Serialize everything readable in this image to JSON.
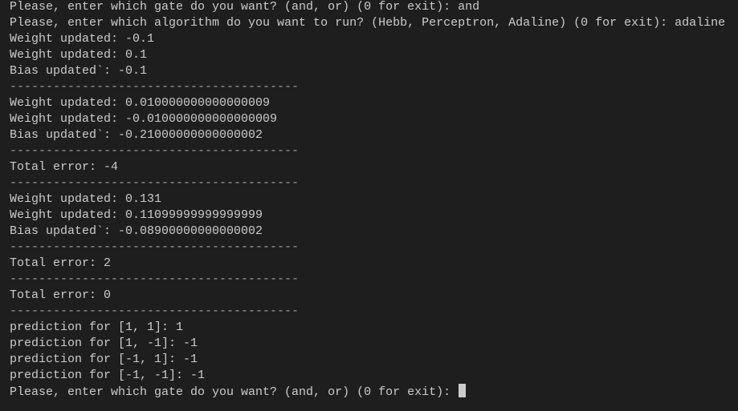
{
  "terminal": {
    "lines": [
      {
        "type": "prompt",
        "text": "Please, enter which gate do you want? (and, or) (0 for exit): ",
        "input": "and"
      },
      {
        "type": "prompt",
        "text": "Please, enter which algorithm do you want to run? (Hebb, Perceptron, Adaline) (0 for exit): ",
        "input": "adaline"
      },
      {
        "type": "output",
        "text": "Weight updated: -0.1"
      },
      {
        "type": "output",
        "text": "Weight updated: 0.1"
      },
      {
        "type": "output",
        "text": "Bias updated`: -0.1"
      },
      {
        "type": "separator",
        "text": "----------------------------------------"
      },
      {
        "type": "output",
        "text": "Weight updated: 0.010000000000000009"
      },
      {
        "type": "output",
        "text": "Weight updated: -0.010000000000000009"
      },
      {
        "type": "output",
        "text": "Bias updated`: -0.21000000000000002"
      },
      {
        "type": "separator",
        "text": "----------------------------------------"
      },
      {
        "type": "output",
        "text": "Total error: -4"
      },
      {
        "type": "separator",
        "text": "----------------------------------------"
      },
      {
        "type": "output",
        "text": "Weight updated: 0.131"
      },
      {
        "type": "output",
        "text": "Weight updated: 0.11099999999999999"
      },
      {
        "type": "output",
        "text": "Bias updated`: -0.08900000000000002"
      },
      {
        "type": "separator",
        "text": "----------------------------------------"
      },
      {
        "type": "output",
        "text": "Total error: 2"
      },
      {
        "type": "separator",
        "text": "----------------------------------------"
      },
      {
        "type": "output",
        "text": "Total error: 0"
      },
      {
        "type": "separator",
        "text": "----------------------------------------"
      },
      {
        "type": "output",
        "text": "prediction for [1, 1]: 1"
      },
      {
        "type": "output",
        "text": "prediction for [1, -1]: -1"
      },
      {
        "type": "output",
        "text": "prediction for [-1, 1]: -1"
      },
      {
        "type": "output",
        "text": "prediction for [-1, -1]: -1"
      }
    ],
    "current_prompt": {
      "text": "Please, enter which gate do you want? (and, or) (0 for exit): ",
      "input": ""
    }
  },
  "colors": {
    "background": "#1e1e1e",
    "foreground": "#cccccc"
  }
}
